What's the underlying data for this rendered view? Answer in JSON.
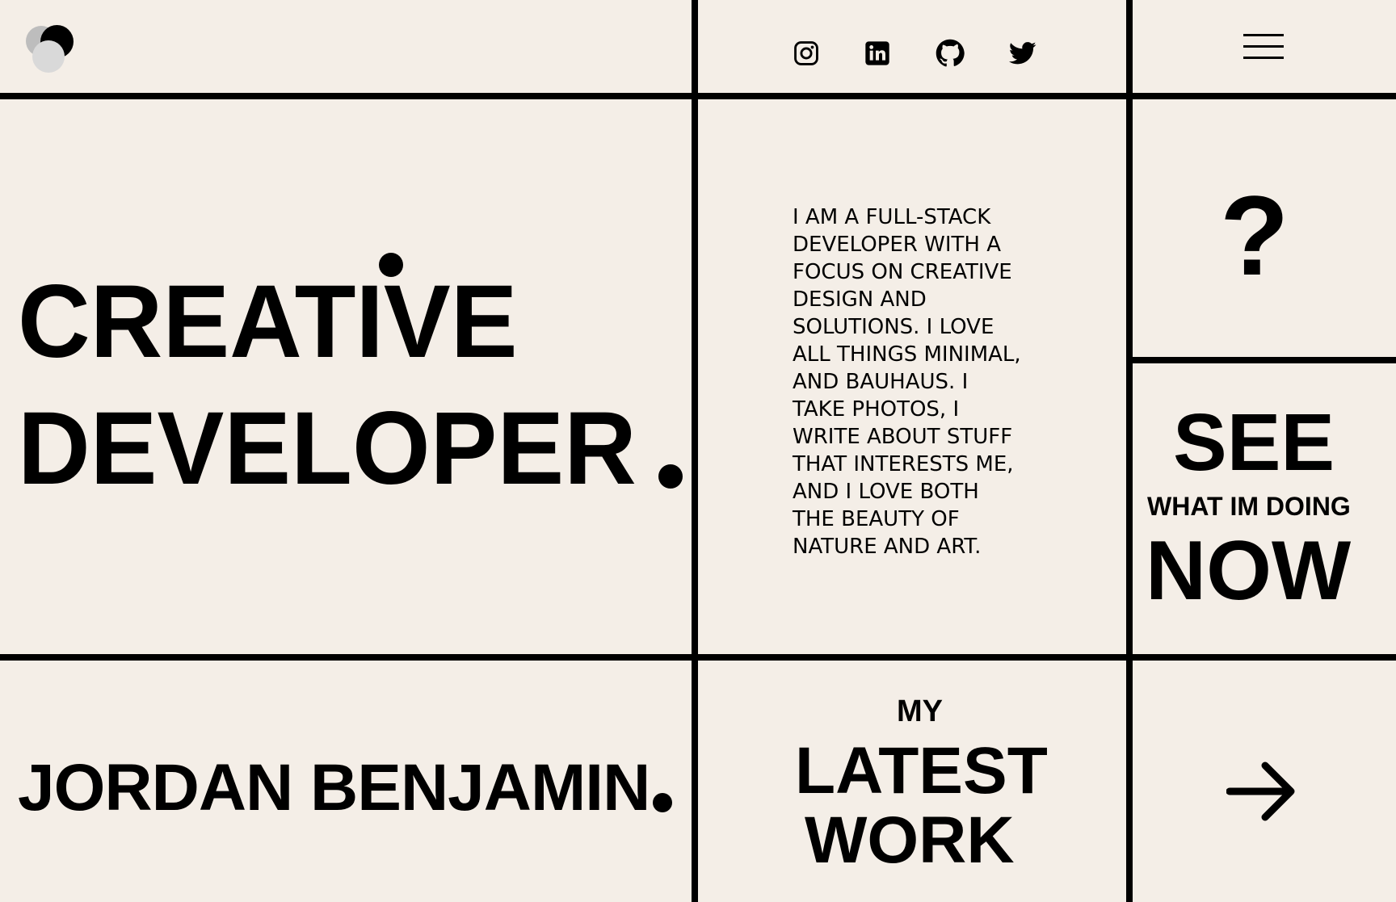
{
  "header": {
    "logo_icon": "logo-circles-icon",
    "social": [
      {
        "name": "instagram-icon"
      },
      {
        "name": "linkedin-icon"
      },
      {
        "name": "github-icon"
      },
      {
        "name": "twitter-icon"
      }
    ],
    "menu_icon": "hamburger-menu-icon"
  },
  "hero": {
    "line1": "CREATIVE",
    "line2": "DEVELOPER"
  },
  "bio": {
    "lines": [
      "I AM A FULL-STACK",
      "DEVELOPER WITH A",
      "FOCUS ON CREATIVE",
      "DESIGN AND",
      "SOLUTIONS. I LOVE",
      "ALL THINGS MINIMAL,",
      "AND BAUHAUS. I",
      "TAKE PHOTOS, I",
      "WRITE ABOUT STUFF",
      "THAT INTERESTS ME,",
      "AND I LOVE BOTH",
      "THE BEAUTY OF",
      "NATURE AND ART."
    ]
  },
  "question": "?",
  "now_panel": {
    "see": "SEE",
    "doing": "WHAT IM DOING",
    "now": "NOW"
  },
  "name": "JORDAN BENJAMIN",
  "latest": {
    "my": "MY",
    "latest": "LATEST",
    "work": "WORK"
  },
  "arrow_icon": "arrow-right-icon",
  "colors": {
    "background": "#f4eee7",
    "ink": "#000000"
  }
}
